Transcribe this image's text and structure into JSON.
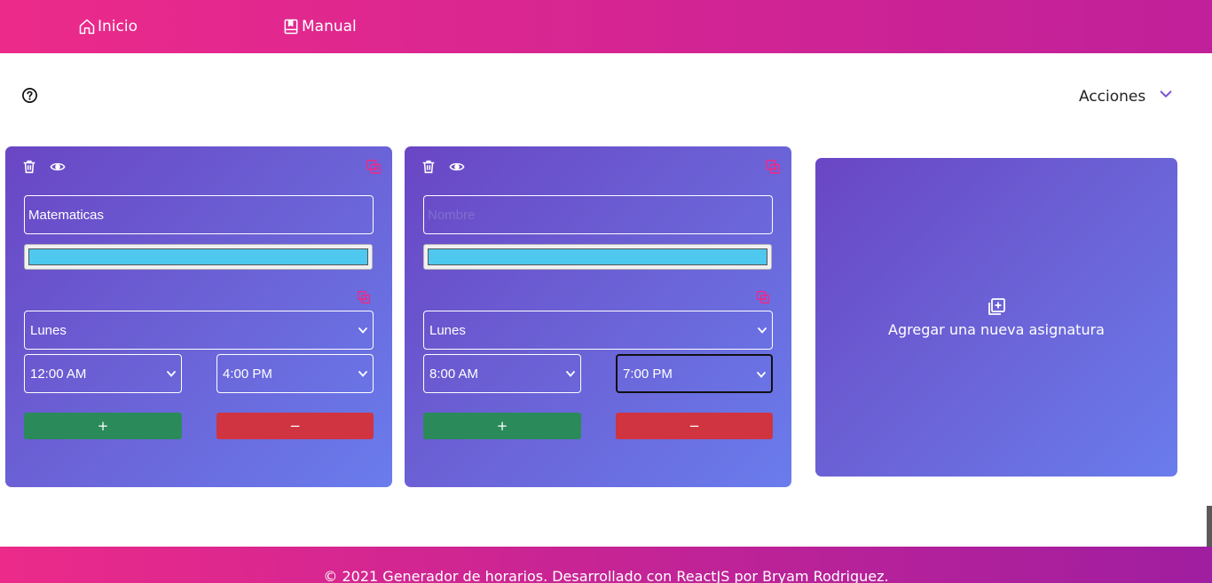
{
  "nav": {
    "home_label": "Inicio",
    "home_icon": "home-icon",
    "manual_label": "Manual",
    "manual_icon": "book-icon"
  },
  "toolbar": {
    "help_icon": "help-circle-icon",
    "actions_label": "Acciones",
    "actions_icon": "chevron-down-icon"
  },
  "colors": {
    "nav_start": "#ec2a8a",
    "nav_end": "#c0209a",
    "card_start": "#6a46c4",
    "card_end": "#6a7cec",
    "accent_pink": "#ec2a8a",
    "add_button": "#2b8a5a",
    "remove_button": "#cf3440",
    "subject_color": "#4ec8ee"
  },
  "subjects": [
    {
      "name_value": "Matematicas",
      "name_placeholder": "Nombre",
      "color": "#4ec8ee",
      "day": "Lunes",
      "start_time": "12:00 AM",
      "end_time": "4:00 PM",
      "add_label": "+",
      "remove_label": "−"
    },
    {
      "name_value": "",
      "name_placeholder": "Nombre",
      "color": "#4ec8ee",
      "day": "Lunes",
      "start_time": "8:00 AM",
      "end_time": "7:00 PM",
      "add_label": "+",
      "remove_label": "−"
    }
  ],
  "add_card": {
    "label": "Agregar una nueva asignatura",
    "icon": "add-square-icon"
  },
  "footer": {
    "text": "© 2021 Generador de horarios. Desarrollado con ReactJS por Bryam Rodriguez."
  }
}
